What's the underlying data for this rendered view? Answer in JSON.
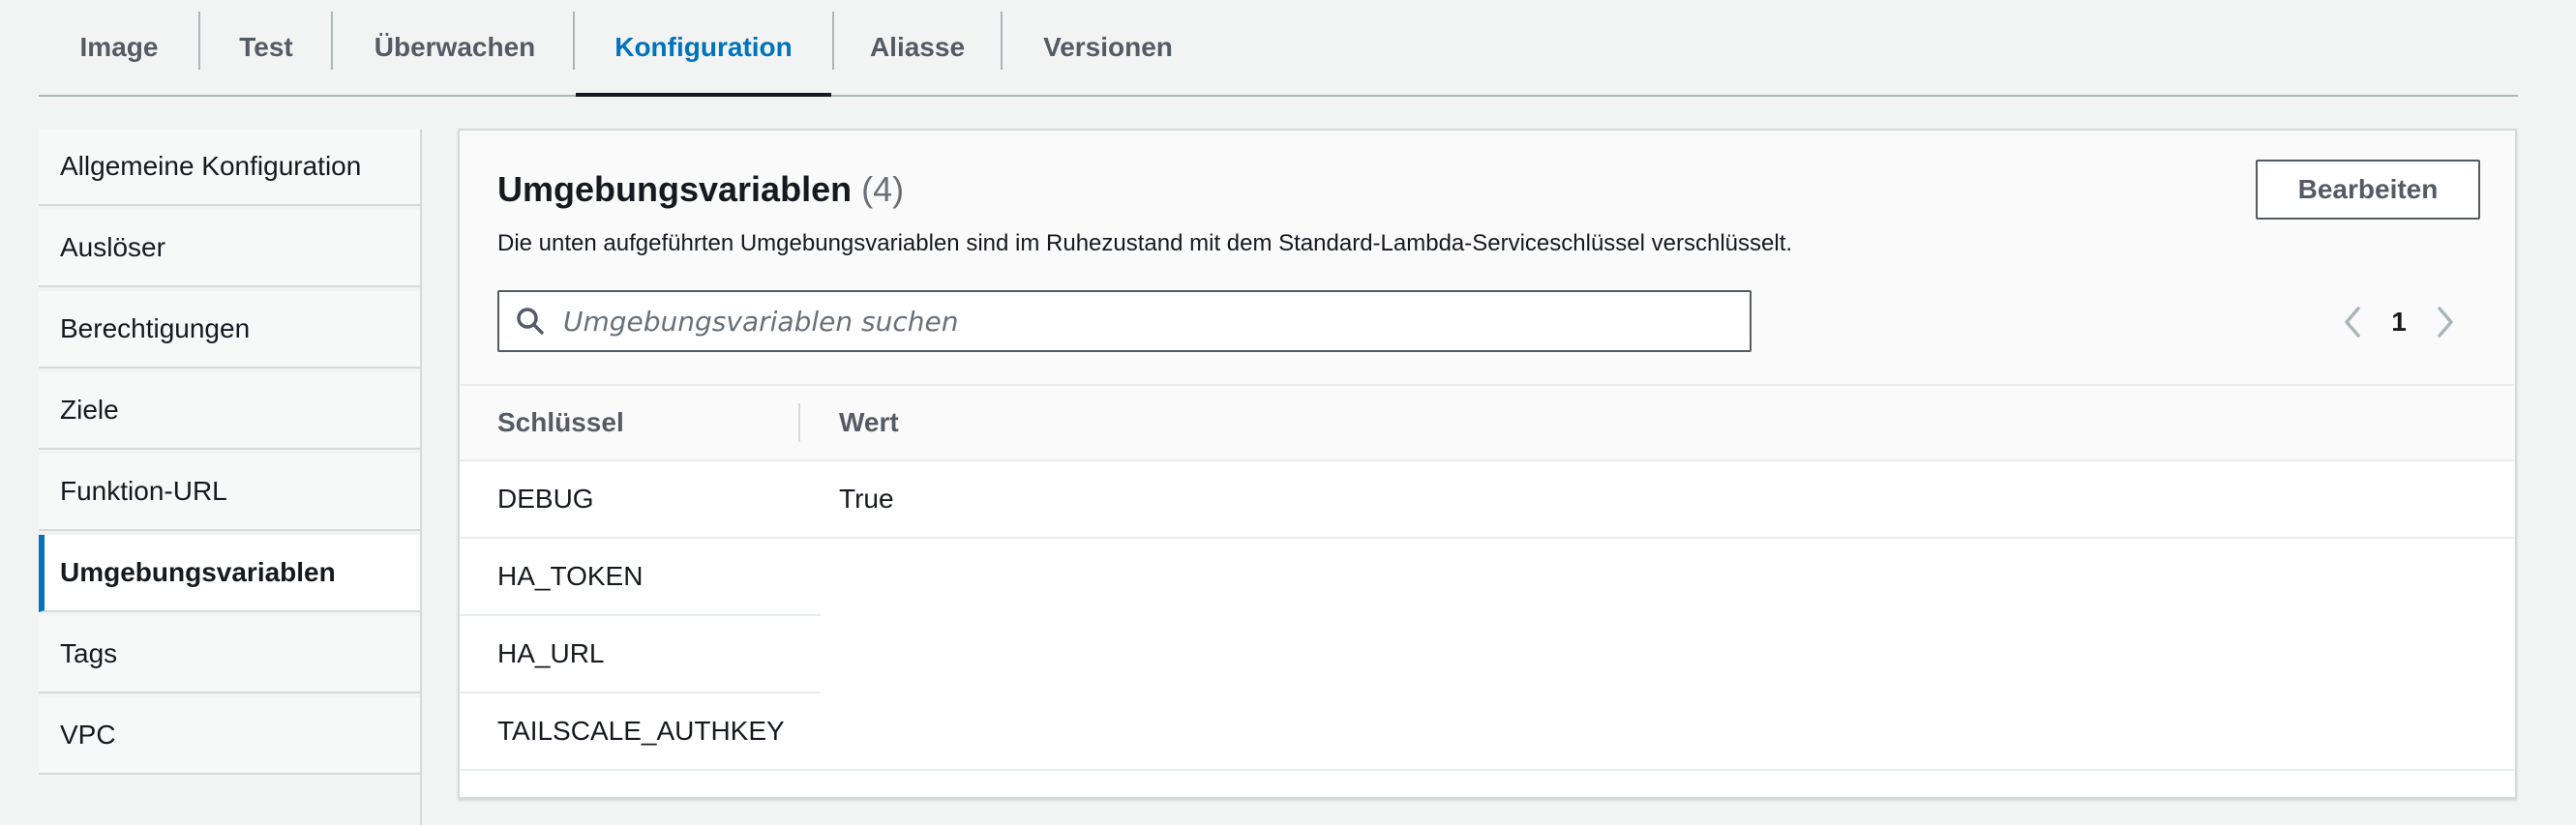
{
  "tabs": [
    {
      "label": "Image"
    },
    {
      "label": "Test"
    },
    {
      "label": "Überwachen"
    },
    {
      "label": "Konfiguration",
      "active": true
    },
    {
      "label": "Aliasse"
    },
    {
      "label": "Versionen"
    }
  ],
  "sidebar": {
    "items": [
      {
        "label": "Allgemeine Konfiguration"
      },
      {
        "label": "Auslöser"
      },
      {
        "label": "Berechtigungen"
      },
      {
        "label": "Ziele"
      },
      {
        "label": "Funktion-URL"
      },
      {
        "label": "Umgebungsvariablen",
        "active": true
      },
      {
        "label": "Tags"
      },
      {
        "label": "VPC"
      }
    ]
  },
  "panel": {
    "title": "Umgebungsvariablen",
    "count": "(4)",
    "description": "Die unten aufgeführten Umgebungsvariablen sind im Ruhezustand mit dem Standard-Lambda-Serviceschlüssel verschlüsselt.",
    "edit_label": "Bearbeiten",
    "search_placeholder": "Umgebungsvariablen suchen",
    "page": "1"
  },
  "table": {
    "columns": [
      "Schlüssel",
      "Wert"
    ],
    "rows": [
      {
        "key": "DEBUG",
        "value": "True"
      },
      {
        "key": "HA_TOKEN",
        "value": ""
      },
      {
        "key": "HA_URL",
        "value": ""
      },
      {
        "key": "TAILSCALE_AUTHKEY",
        "value": ""
      }
    ]
  },
  "colors": {
    "accent": "#0073bb",
    "text": "#16191f",
    "muted": "#545b64"
  }
}
